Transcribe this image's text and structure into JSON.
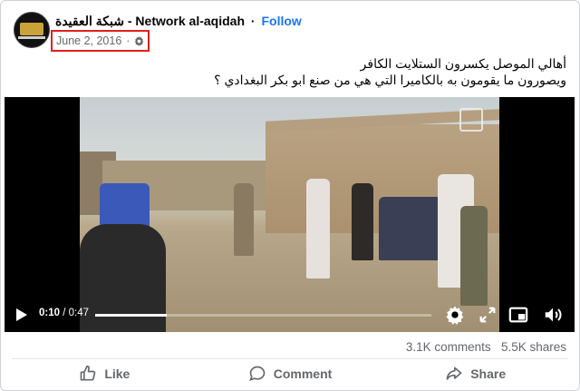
{
  "post": {
    "page_name": "شبكة العقيدة - Network al-aqidah",
    "separator": "·",
    "follow_label": "Follow",
    "date": "June 2, 2016",
    "meta_dot": "·",
    "caption_line1": "أهالي الموصل يكسرون الستلايت  الكافر",
    "caption_line2": "ويصورون ما يقومون به بالكاميرا التي هي من صنع  ابو بكر البغدادي ؟"
  },
  "video": {
    "current_time": "0:10",
    "duration_text": " / 0:47",
    "progress_fraction": 0.213
  },
  "stats": {
    "comments": "3.1K comments",
    "shares": "5.5K shares"
  },
  "actions": {
    "like": "Like",
    "comment": "Comment",
    "share": "Share"
  },
  "colors": {
    "accent": "#1877f2",
    "highlight_box": "#e0201e",
    "muted_text": "#65676b"
  }
}
